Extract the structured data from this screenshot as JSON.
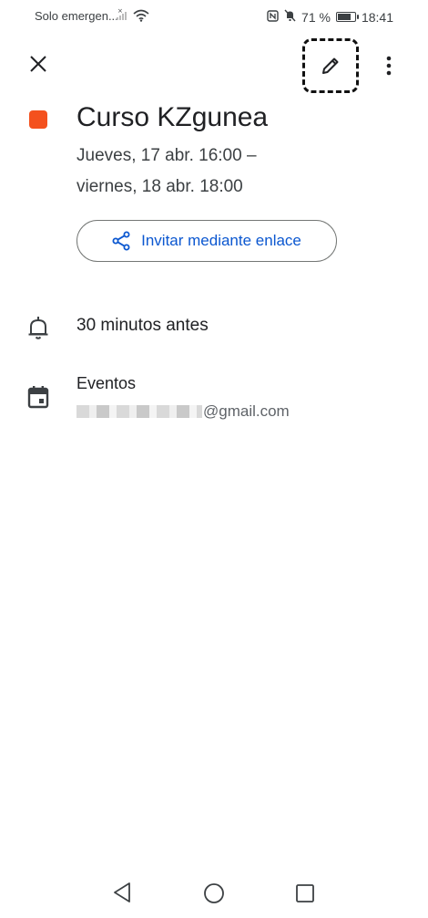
{
  "status_bar": {
    "carrier_text": "Solo emergen...",
    "battery_percent": "71 %",
    "battery_level": 0.71,
    "time": "18:41"
  },
  "toolbar": {
    "close_icon": "close-icon",
    "edit_icon": "pencil-icon",
    "more_icon": "more-vert-icon"
  },
  "event": {
    "color": "#f4511e",
    "title": "Curso KZgunea",
    "date_line1": "Jueves, 17 abr. 16:00 –",
    "date_line2": "viernes, 18 abr. 18:00",
    "invite_label": "Invitar mediante enlace",
    "invite_icon": "share-icon"
  },
  "reminder": {
    "icon": "bell-icon",
    "text": "30 minutos antes"
  },
  "calendar": {
    "icon": "calendar-icon",
    "name": "Eventos",
    "account_suffix": "@gmail.com"
  },
  "nav_bar": {
    "back_icon": "back-triangle-icon",
    "home_icon": "home-circle-icon",
    "recents_icon": "recents-square-icon"
  },
  "colors": {
    "accent": "#0b57d0",
    "event": "#f4511e"
  }
}
